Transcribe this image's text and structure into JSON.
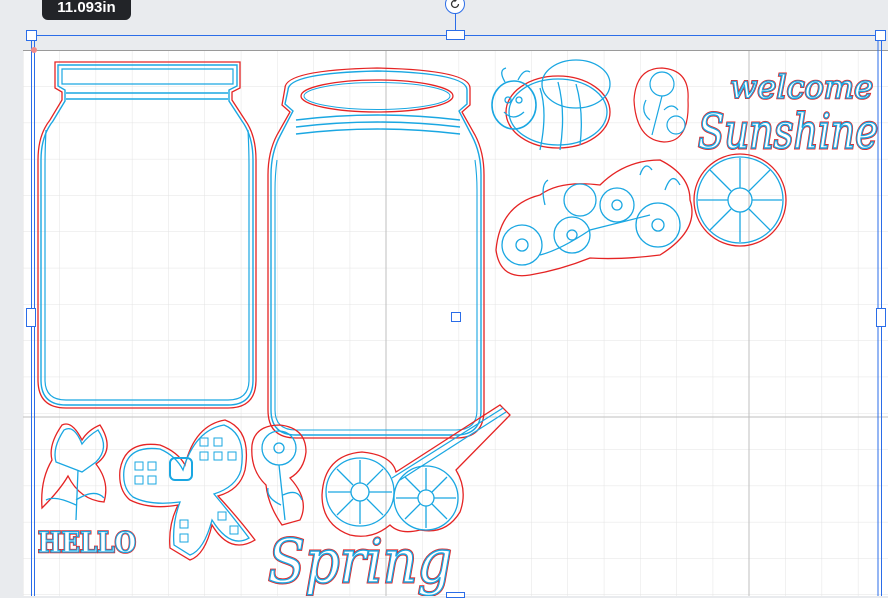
{
  "selection": {
    "dimension_label": "11.093in"
  },
  "design": {
    "texts": {
      "welcome": "welcome",
      "sunshine": "Sunshine",
      "hello": "HELLO",
      "spring": "Spring"
    }
  },
  "colors": {
    "cut_line": "#e52424",
    "design_line": "#1aa7e2",
    "selection": "#2b6de8",
    "grid_minor": "#e4e4e4",
    "grid_major": "#bdbdbd",
    "workspace": "#e9ebee",
    "mat": "#ffffff"
  }
}
